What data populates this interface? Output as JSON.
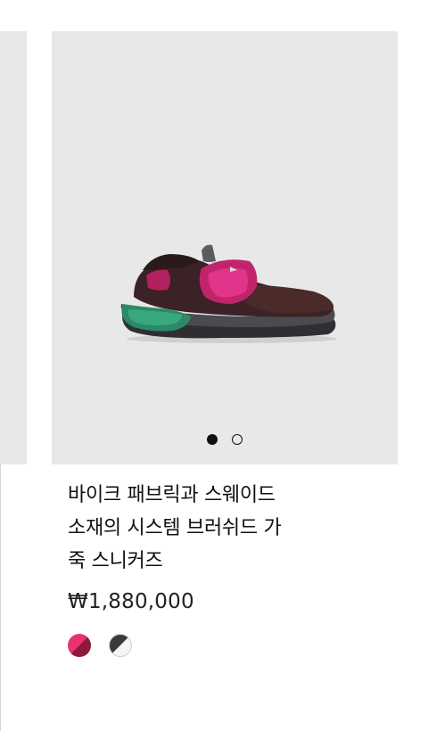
{
  "product": {
    "title_lines": [
      "바이크 패브릭과 스웨이드",
      "소재의 시스템 브러쉬드 가",
      "죽 스니커즈"
    ],
    "price": "₩1,880,000"
  },
  "carousel": {
    "slide_count": 2,
    "active_index": 1
  },
  "swatches": [
    {
      "name": "pink-burgundy",
      "colors": [
        "#e8326d",
        "#8d1a3c"
      ]
    },
    {
      "name": "black-white",
      "colors": [
        "#3a3a3a",
        "#f5f5f3"
      ]
    }
  ],
  "colors": {
    "image_background": "#e8e8e8",
    "text": "#111111"
  }
}
